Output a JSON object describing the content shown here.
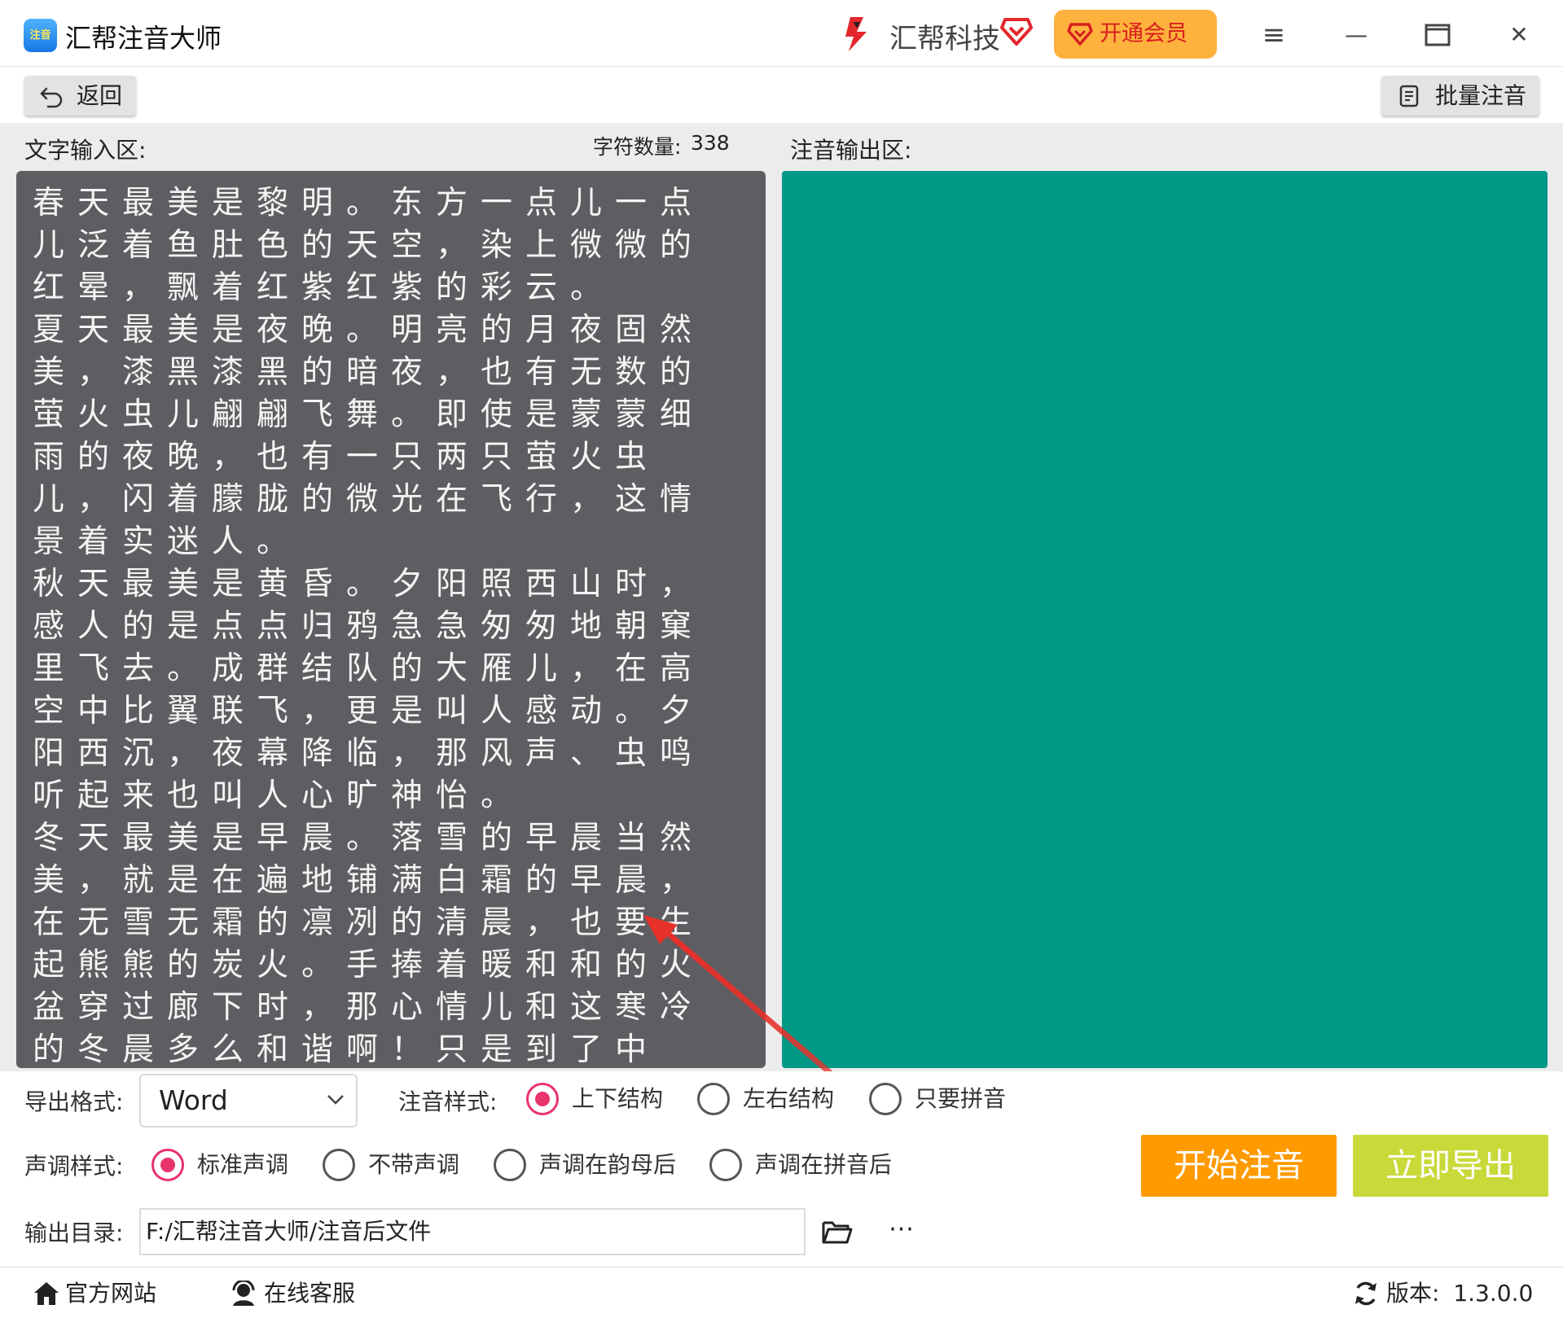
{
  "app": {
    "title": "汇帮注音大师",
    "icon_text": "注音",
    "brand_name": "汇帮科技",
    "vip_label": "开通会员"
  },
  "window_controls": {
    "menu": "≡",
    "minimize": "—",
    "maximize": "□",
    "close": "✕"
  },
  "toolbar": {
    "back_label": "返回",
    "batch_label": "批量注音"
  },
  "input": {
    "label": "文字输入区:",
    "count_label": "字符数量:",
    "count_value": "338",
    "text": "春天最美是黎明。东方一点儿一点儿泛着鱼肚色的天空，染上微微的红晕，飘着红紫红紫的彩云。\n夏天最美是夜晚。明亮的月夜固然美，漆黑漆黑的暗夜，也有无数的萤火虫儿翩翩飞舞。即使是蒙蒙细雨的夜晚，也有一只两只萤火虫儿，闪着朦胧的微光在飞行，这情景着实迷人。\n秋天最美是黄昏。夕阳照西山时，感人的是点点归鸦急急匆匆地朝窠里飞去。成群结队的大雁儿，在高空中比翼联飞，更是叫人感动。夕阳西沉，夜幕降临，那风声、虫鸣听起来也叫人心旷神怡。\n冬天最美是早晨。落雪的早晨当然美，就是在遍地铺满白霜的早晨，在无雪无霜的凛冽的清晨，也要生起熊熊的炭火。手捧着暖和和的火盆穿过廊下时，那心情儿和这寒冷的冬晨多么和谐啊！只是到了中午，寒气渐"
  },
  "output": {
    "label": "注音输出区:"
  },
  "settings": {
    "format_label": "导出格式:",
    "format_value": "Word",
    "style_label": "注音样式:",
    "style_options": [
      "上下结构",
      "左右结构",
      "只要拼音"
    ],
    "style_selected": "上下结构",
    "tone_label": "声调样式:",
    "tone_options": [
      "标准声调",
      "不带声调",
      "声调在韵母后",
      "声调在拼音后"
    ],
    "tone_selected": "标准声调",
    "start_label": "开始注音",
    "export_label": "立即导出",
    "dir_label": "输出目录:",
    "dir_value": "F:/汇帮注音大师/注音后文件",
    "more_label": "···"
  },
  "footer": {
    "website_label": "官方网站",
    "service_label": "在线客服",
    "version_label": "版本:",
    "version_value": "1.3.0.0"
  },
  "colors": {
    "input_bg": "#5e5e62",
    "output_bg": "#009988",
    "start_btn": "#ff9a00",
    "export_btn": "#c9d93a",
    "vip_btn": "#ffb13d",
    "radio_accent": "#e8336b",
    "annotation_arrow": "#e8302a"
  }
}
